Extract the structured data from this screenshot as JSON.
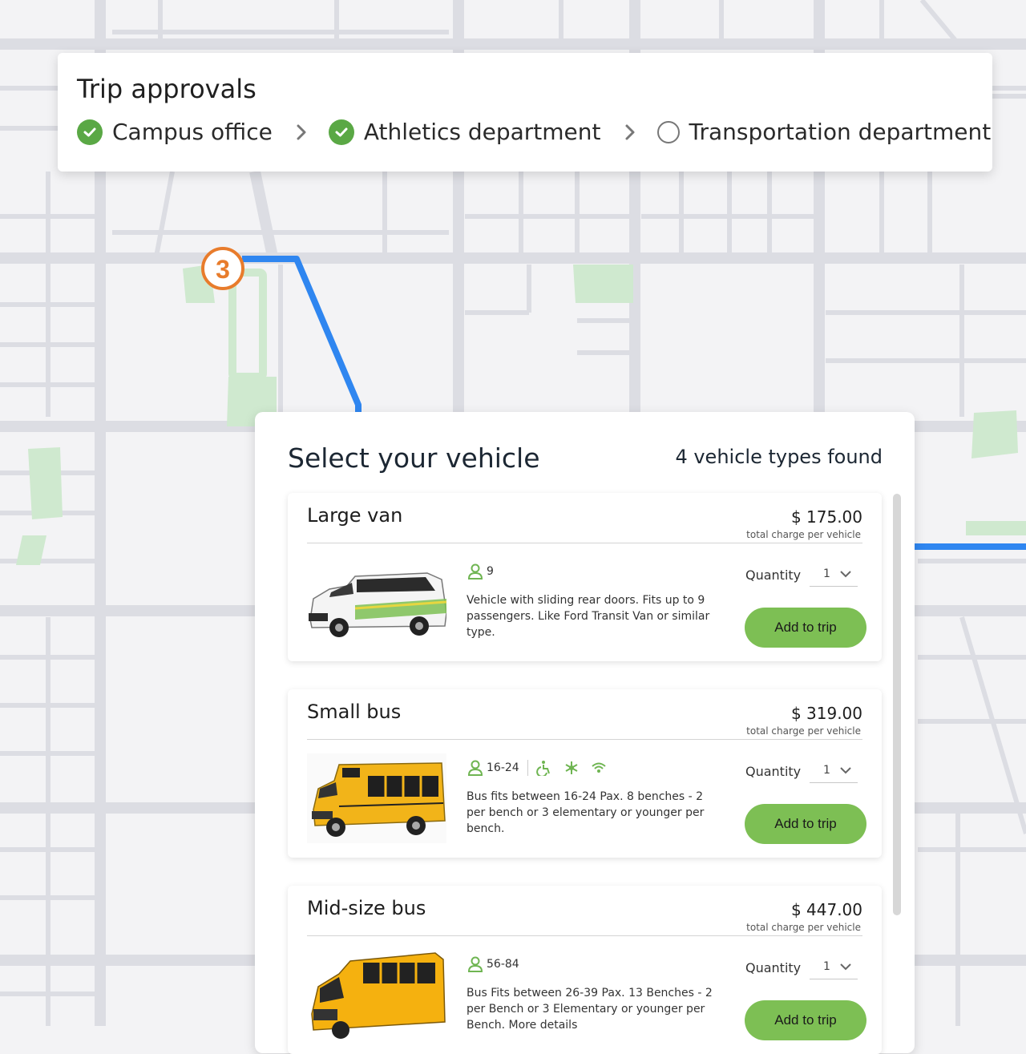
{
  "map": {
    "colors": {
      "background": "#f3f3f5",
      "road": "#dcdde3",
      "park": "#cfe9cf",
      "route": "#2f86f0",
      "marker": "#e87c2c"
    },
    "route_marker": {
      "label": "3"
    }
  },
  "approvals": {
    "title": "Trip approvals",
    "steps": [
      {
        "label": "Campus office",
        "status": "approved",
        "icon": "check-circle-icon"
      },
      {
        "label": "Athletics department",
        "status": "approved",
        "icon": "check-circle-icon"
      },
      {
        "label": "Transportation department",
        "status": "pending",
        "icon": "empty-circle-icon"
      }
    ],
    "separator_icon": "chevron-right-icon"
  },
  "vehicles": {
    "heading": "Select your vehicle",
    "found": "4 vehicle types found",
    "items": [
      {
        "name": "Large van",
        "price": "$  175.00",
        "price_note": "total charge per vehicle",
        "capacity": "9",
        "amenities": [],
        "description": "Vehicle with sliding rear doors. Fits up to 9 passengers. Like Ford Transit Van or similar type.",
        "quantity_label": "Quantity",
        "quantity": "1",
        "button": "Add to trip",
        "photo": "white-van-image"
      },
      {
        "name": "Small bus",
        "price": "$ 319.00",
        "price_note": "total charge per vehicle",
        "capacity": "16-24",
        "amenities": [
          "wheelchair-icon",
          "air-conditioning-icon",
          "wifi-icon"
        ],
        "description": "Bus fits between 16-24 Pax. 8 benches - 2 per bench or 3 elementary or younger per bench.",
        "quantity_label": "Quantity",
        "quantity": "1",
        "button": "Add  to trip",
        "photo": "small-yellow-bus-image"
      },
      {
        "name": "Mid-size bus",
        "price": "$ 447.00",
        "price_note": "total charge per vehicle",
        "capacity": "56-84",
        "amenities": [],
        "description": "Bus Fits between 26-39 Pax. 13 Benches - 2 per Bench or 3 Elementary or younger per Bench. More details",
        "quantity_label": "Quantity",
        "quantity": "1",
        "button": "Add to trip",
        "photo": "school-bus-image"
      }
    ]
  }
}
